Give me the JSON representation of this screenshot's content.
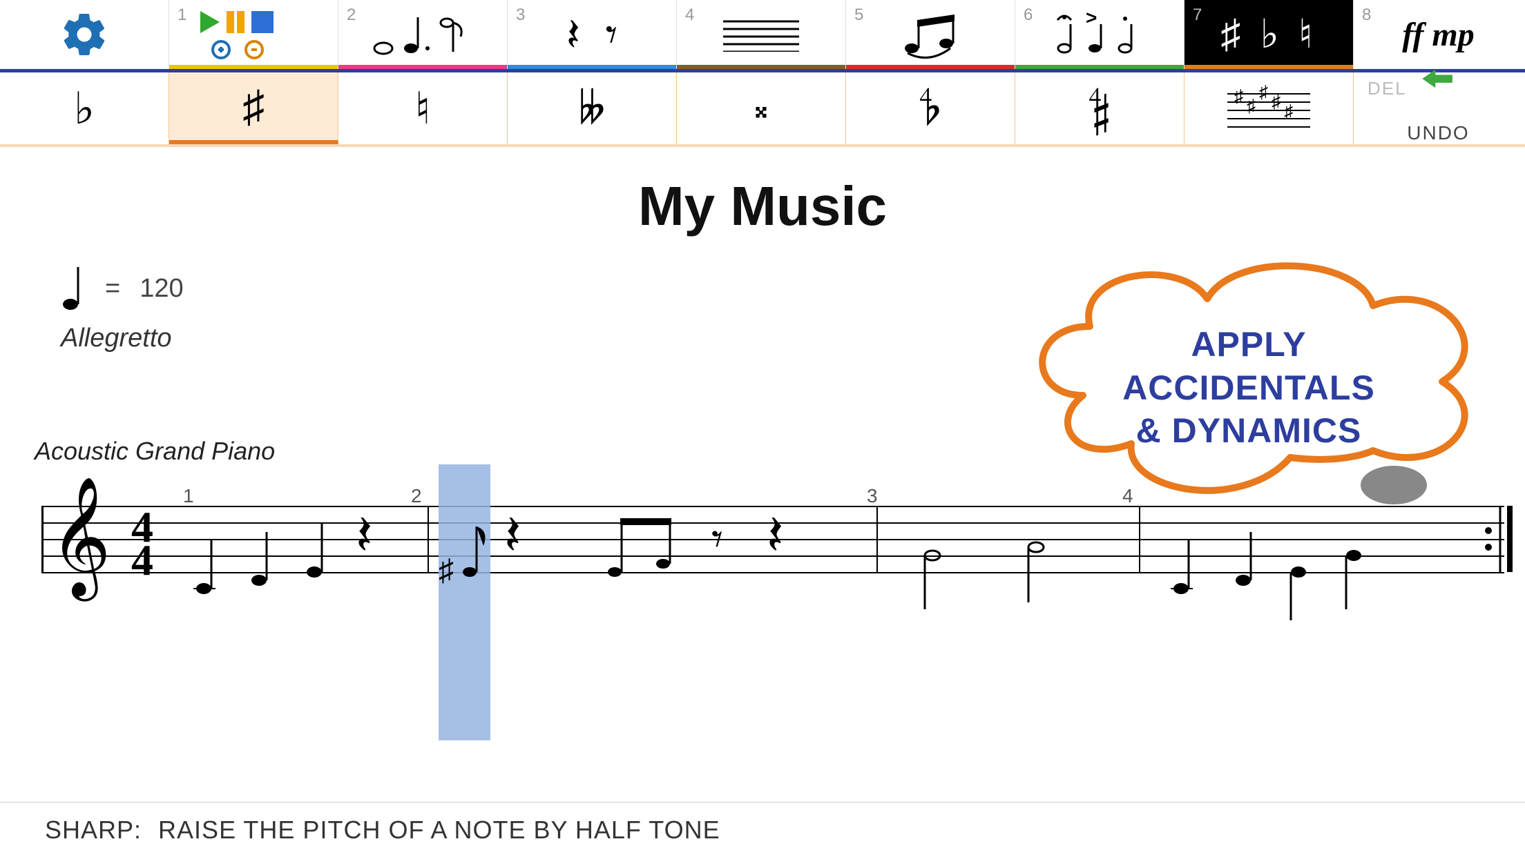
{
  "toolbar1": {
    "items": [
      {
        "num": "",
        "name": "settings",
        "underbar": ""
      },
      {
        "num": "1",
        "name": "playback",
        "underbar": "#f2c300"
      },
      {
        "num": "2",
        "name": "notes",
        "underbar": "#e83d84"
      },
      {
        "num": "3",
        "name": "rests",
        "underbar": "#2d8fd6"
      },
      {
        "num": "4",
        "name": "staff",
        "underbar": "#8a5a2a"
      },
      {
        "num": "5",
        "name": "ties",
        "underbar": "#d92b2b"
      },
      {
        "num": "6",
        "name": "articulation",
        "underbar": "#3fa83f"
      },
      {
        "num": "7",
        "name": "accidentals",
        "underbar": "#e8791d",
        "selected": true
      },
      {
        "num": "8",
        "name": "dynamics",
        "underbar": ""
      }
    ],
    "dynamics_label": "ff mp"
  },
  "toolbar2": {
    "items": [
      {
        "name": "flat",
        "glyph": "♭"
      },
      {
        "name": "sharp",
        "glyph": "♯",
        "selected": true
      },
      {
        "name": "natural",
        "glyph": "♮"
      },
      {
        "name": "double-flat",
        "glyph": "𝄫"
      },
      {
        "name": "double-sharp",
        "glyph": "𝄪"
      },
      {
        "name": "half-flat",
        "glyph": "𝄳"
      },
      {
        "name": "half-sharp",
        "glyph": "𝄲"
      },
      {
        "name": "key-signature",
        "glyph": ""
      }
    ],
    "undo": {
      "del": "DEL",
      "label": "UNDO"
    }
  },
  "score": {
    "title": "My Music",
    "tempo_eq": "=",
    "tempo_bpm": "120",
    "tempo_term": "Allegretto",
    "instrument": "Acoustic Grand Piano",
    "time_sig_top": "4",
    "time_sig_bot": "4",
    "bar_numbers": [
      "1",
      "2",
      "3",
      "4"
    ],
    "selected_note_bar": 2
  },
  "callout": {
    "line1": "APPLY",
    "line2": "ACCIDENTALS",
    "line3": "& DYNAMICS"
  },
  "infobar": {
    "term": "SHARP:",
    "desc": "RAISE THE PITCH OF A NOTE BY HALF TONE"
  }
}
